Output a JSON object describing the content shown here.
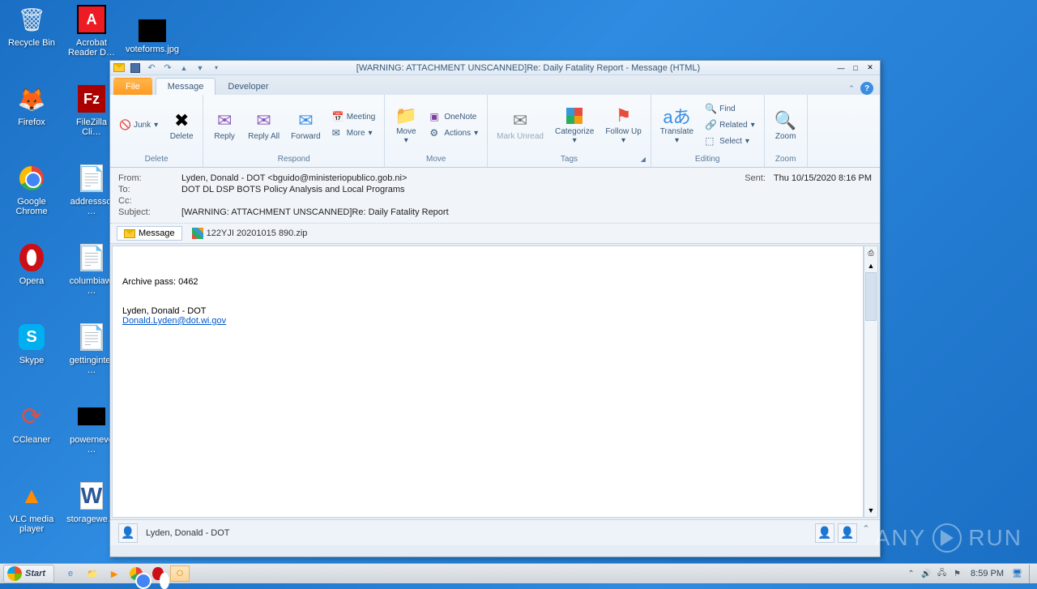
{
  "desktop": {
    "icons": [
      {
        "label": "Recycle Bin"
      },
      {
        "label": "Acrobat Reader D…"
      },
      {
        "label": "voteforms.jpg"
      },
      {
        "label": "Firefox"
      },
      {
        "label": "FileZilla Cli…"
      },
      {
        "label": "Google Chrome"
      },
      {
        "label": "addresssci…"
      },
      {
        "label": "Opera"
      },
      {
        "label": "columbiawi…"
      },
      {
        "label": "Skype"
      },
      {
        "label": "gettinginter…"
      },
      {
        "label": "CCleaner"
      },
      {
        "label": "powerneve…"
      },
      {
        "label": "VLC media player"
      },
      {
        "label": "storagewe…"
      }
    ]
  },
  "window": {
    "title": "[WARNING: ATTACHMENT UNSCANNED]Re: Daily Fatality Report  -  Message (HTML)",
    "tabs": {
      "file": "File",
      "message": "Message",
      "developer": "Developer"
    },
    "ribbon": {
      "junk": "Junk",
      "delete": "Delete",
      "delete_group": "Delete",
      "reply": "Reply",
      "replyall": "Reply All",
      "forward": "Forward",
      "meeting": "Meeting",
      "more": "More",
      "respond_group": "Respond",
      "move": "Move",
      "onenote": "OneNote",
      "actions": "Actions",
      "move_group": "Move",
      "markunread": "Mark Unread",
      "categorize": "Categorize",
      "followup": "Follow Up",
      "tags_group": "Tags",
      "translate": "Translate",
      "find": "Find",
      "related": "Related",
      "select": "Select",
      "editing_group": "Editing",
      "zoom": "Zoom",
      "zoom_group": "Zoom"
    },
    "headers": {
      "from_label": "From:",
      "from": "Lyden, Donald - DOT <bguido@ministeriopublico.gob.ni>",
      "sent_label": "Sent:",
      "sent": "Thu 10/15/2020 8:16 PM",
      "to_label": "To:",
      "to": "DOT DL DSP BOTS Policy Analysis and Local Programs",
      "cc_label": "Cc:",
      "cc": "",
      "subject_label": "Subject:",
      "subject": "[WARNING: ATTACHMENT UNSCANNED]Re: Daily Fatality Report"
    },
    "attach": {
      "msg_tab": "Message",
      "file": "122YJI 20201015 890.zip"
    },
    "body": {
      "line1": "Archive pass: 0462",
      "sig_name": "Lyden, Donald - DOT",
      "sig_email": "Donald.Lyden@dot.wi.gov"
    },
    "people": "Lyden, Donald - DOT"
  },
  "taskbar": {
    "start": "Start",
    "time": "8:59 PM"
  },
  "watermark": {
    "a": "ANY",
    "b": "RUN"
  }
}
